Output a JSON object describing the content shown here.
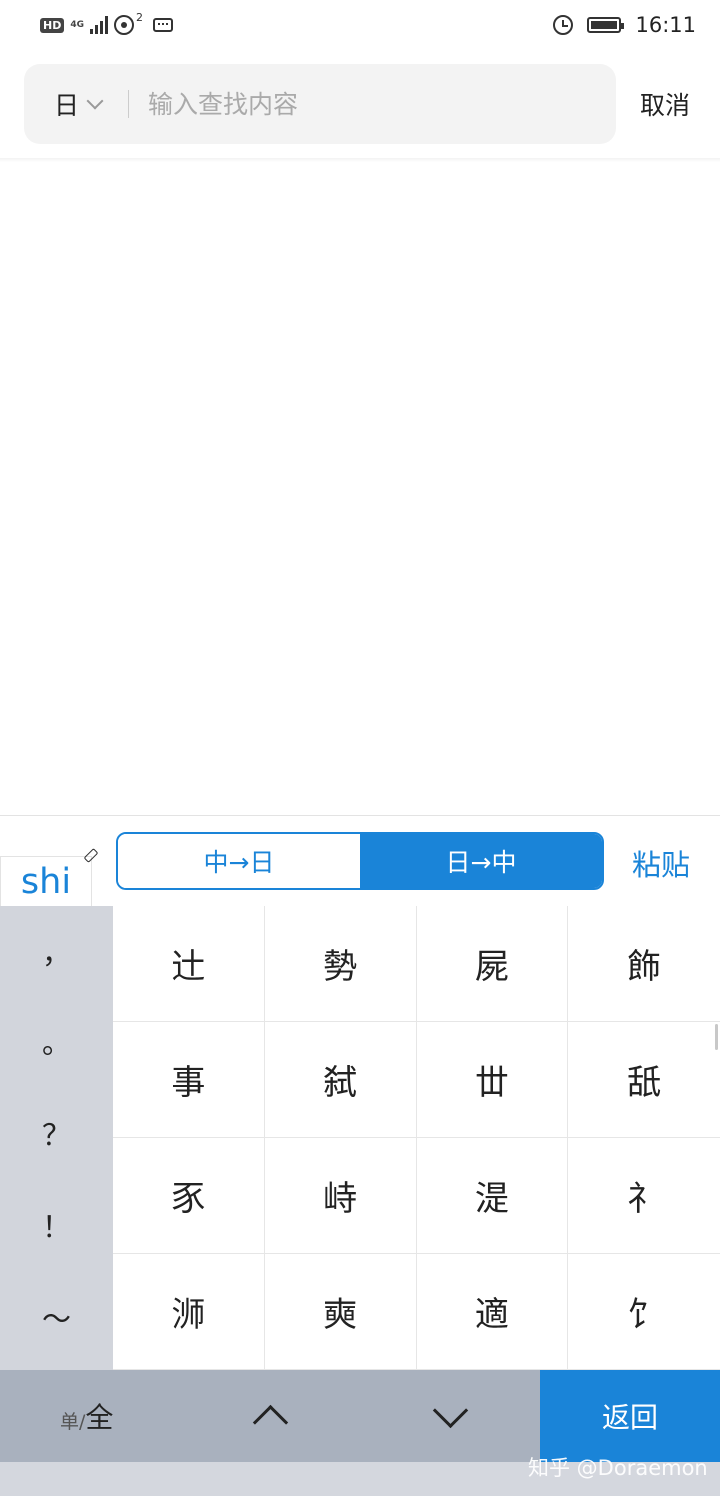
{
  "status_bar": {
    "hd": "HD",
    "network": "4G",
    "hotspot_count": "2",
    "time": "16:11",
    "icons": [
      "hd-icon",
      "signal-icon",
      "hotspot-icon",
      "keyboard-icon",
      "alarm-icon",
      "battery-icon"
    ]
  },
  "search": {
    "language": "日",
    "placeholder": "输入查找内容",
    "value": "",
    "cancel_label": "取消"
  },
  "ime": {
    "pinyin": "shi",
    "mode_zh_ja": "中→日",
    "mode_ja_zh": "日→中",
    "active_mode": "日→中",
    "paste_label": "粘贴",
    "accent_color": "#1a84d8"
  },
  "keyboard": {
    "punctuation": [
      "，",
      "。",
      "？",
      "！",
      "～"
    ],
    "candidates": [
      "辻",
      "勢",
      "屍",
      "飾",
      "事",
      "弑",
      "丗",
      "舐",
      "豕",
      "峙",
      "湜",
      "礻",
      "浉",
      "奭",
      "適",
      "饣"
    ],
    "full_half_small": "单/",
    "full_half_big": "全",
    "return_label": "返回"
  },
  "watermark": "知乎 @Doraemon"
}
